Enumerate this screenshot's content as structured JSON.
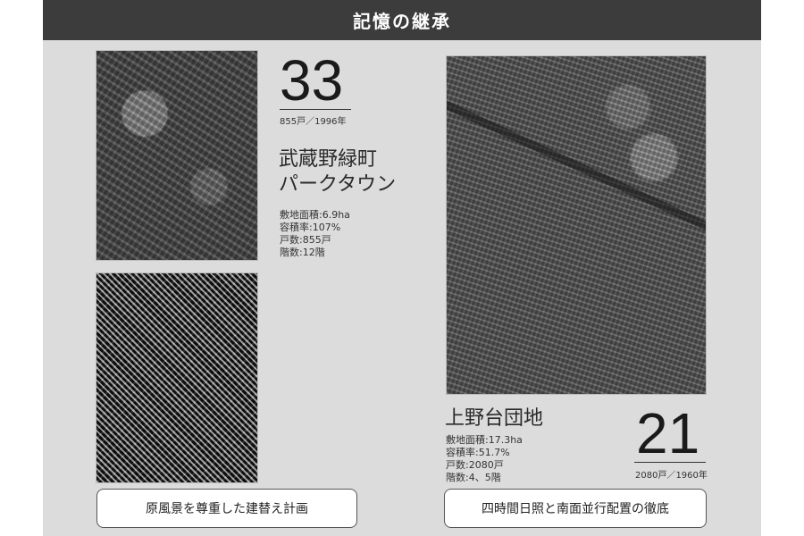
{
  "header": {
    "title": "記憶の継承"
  },
  "left": {
    "number": "33",
    "meta": "855戸／1996年",
    "name_line1": "武蔵野緑町",
    "name_line2": "パークタウン",
    "specs": [
      "敷地面積:6.9ha",
      "容積率:107%",
      "戸数:855戸",
      "階数:12階"
    ],
    "caption": "原風景を尊重した建替え計画"
  },
  "right": {
    "number": "21",
    "meta": "2080戸／1960年",
    "name": "上野台団地",
    "specs": [
      "敷地面積:17.3ha",
      "容積率:51.7%",
      "戸数:2080戸",
      "階数:4、5階"
    ],
    "caption": "四時間日照と南面並行配置の徹底"
  }
}
